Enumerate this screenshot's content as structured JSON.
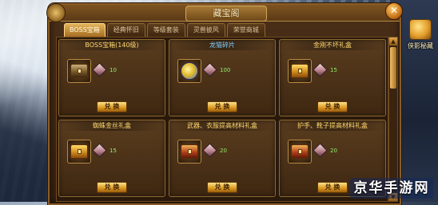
{
  "window": {
    "title": "藏宝阁",
    "close_label": "✕"
  },
  "tabs": [
    {
      "label": "BOSS宝箱",
      "active": true
    },
    {
      "label": "经典怀旧",
      "active": false
    },
    {
      "label": "等级套装",
      "active": false
    },
    {
      "label": "灵兽披风",
      "active": false
    },
    {
      "label": "荣誉商城",
      "active": false
    }
  ],
  "items": [
    {
      "title": "BOSS宝箱(140级)",
      "title_color": "gold",
      "icon": "treasure-chest-icon",
      "cost": "10",
      "button": "兑 换"
    },
    {
      "title": "龙猫碎片",
      "title_color": "blue",
      "icon": "pet-fragment-icon",
      "cost": "100",
      "button": "兑 换"
    },
    {
      "title": "金刚不坏礼盒",
      "title_color": "gold",
      "icon": "treasure-chest-icon",
      "cost": "15",
      "button": "兑 换"
    },
    {
      "title": "蜘蛛金丝礼盒",
      "title_color": "gold",
      "icon": "treasure-chest-icon",
      "cost": "15",
      "button": "兑 换"
    },
    {
      "title": "武器、衣服提高材料礼盒",
      "title_color": "gold",
      "icon": "red-chest-icon",
      "cost": "20",
      "button": "兑 换"
    },
    {
      "title": "护手、靴子提高材料礼盒",
      "title_color": "gold",
      "icon": "red-chest-icon",
      "cost": "20",
      "button": "兑 换"
    }
  ],
  "side": {
    "label": "侠影秘藏"
  },
  "watermark": "京华手游网",
  "colors": {
    "accent": "#e3b35a",
    "cost_text": "#8ff06a",
    "title_gold": "#ffd872",
    "title_blue": "#7fd0ff"
  }
}
